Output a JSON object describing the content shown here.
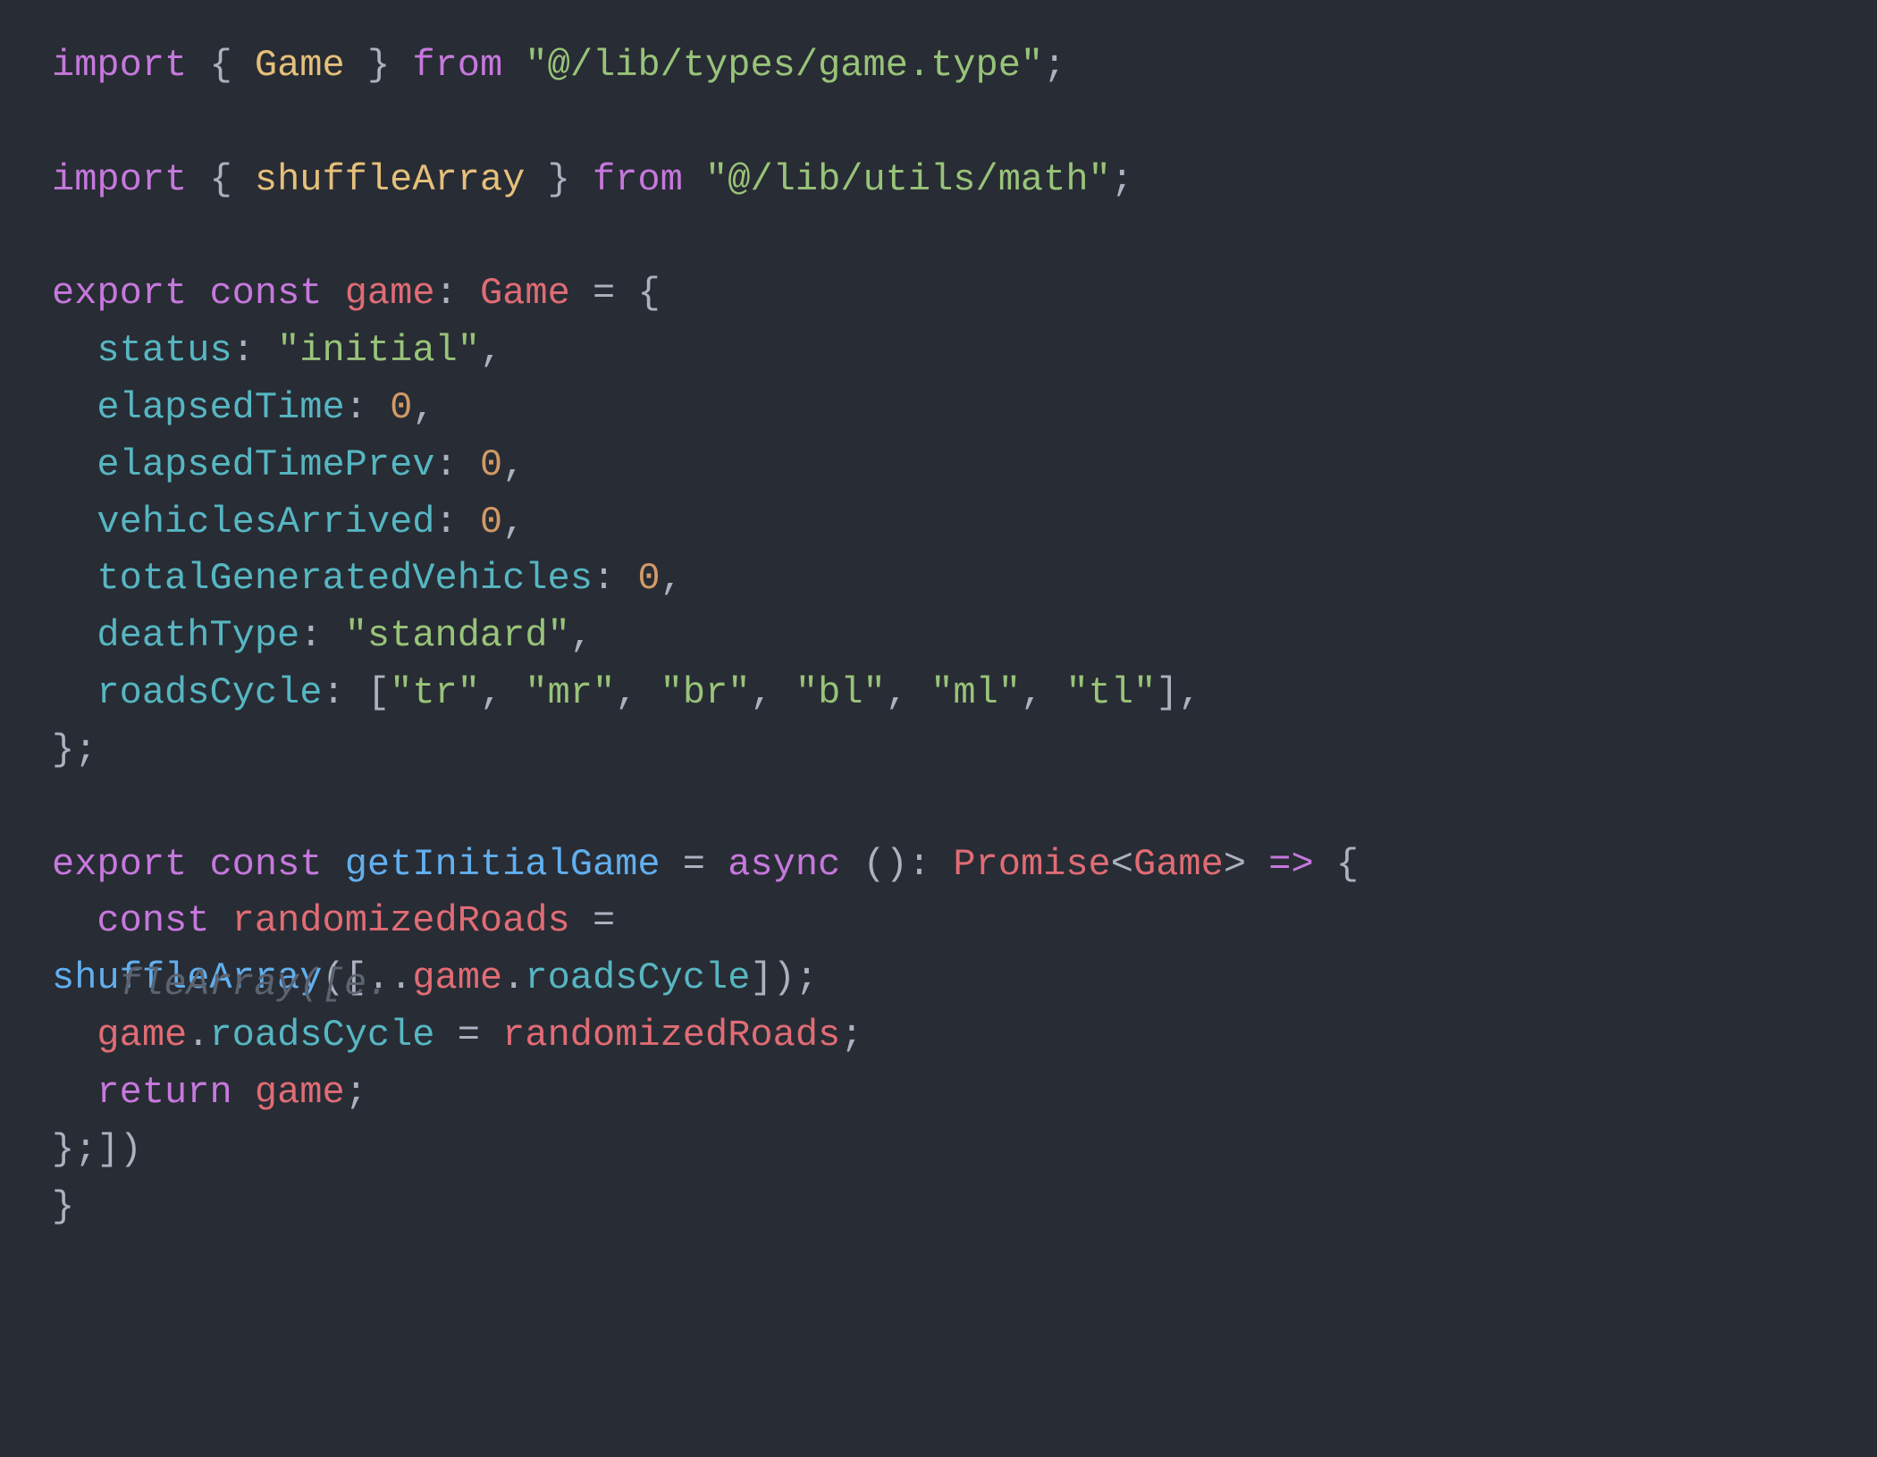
{
  "line1": {
    "kw_import": "import",
    "brace_open": "{",
    "ident_Game": "Game",
    "brace_close": "}",
    "kw_from": "from",
    "str_path": "\"@/lib/types/game.type\"",
    "semi": ";"
  },
  "line3": {
    "kw_import": "import",
    "brace_open": "{",
    "ident_shuffleArray": "shuffleArray",
    "brace_close": "}",
    "kw_from": "from",
    "str_path": "\"@/lib/utils/math\"",
    "semi": ";"
  },
  "line5": {
    "kw_export": "export",
    "kw_const": "const",
    "ident_game": "game",
    "colon": ":",
    "type_Game": "Game",
    "eq": "=",
    "brace_open": "{"
  },
  "line6": {
    "prop": "status",
    "colon": ":",
    "str": "\"initial\"",
    "comma": ","
  },
  "line7": {
    "prop": "elapsedTime",
    "colon": ":",
    "num": "0",
    "comma": ","
  },
  "line8": {
    "prop": "elapsedTimePrev",
    "colon": ":",
    "num": "0",
    "comma": ","
  },
  "line9": {
    "prop": "vehiclesArrived",
    "colon": ":",
    "num": "0",
    "comma": ","
  },
  "line10": {
    "prop": "totalGeneratedVehicles",
    "colon": ":",
    "num": "0",
    "comma": ","
  },
  "line11": {
    "prop": "deathType",
    "colon": ":",
    "str": "\"standard\"",
    "comma": ","
  },
  "line12": {
    "prop": "roadsCycle",
    "colon": ":",
    "lbrack": "[",
    "s1": "\"tr\"",
    "c1": ",",
    "s2": "\"mr\"",
    "c2": ",",
    "s3": "\"br\"",
    "c3": ",",
    "s4": "\"bl\"",
    "c4": ",",
    "s5": "\"ml\"",
    "c5": ",",
    "s6": "\"tl\"",
    "rbrack": "]",
    "comma": ","
  },
  "line13": {
    "brace_close": "}",
    "semi": ";"
  },
  "line15": {
    "kw_export": "export",
    "kw_const": "const",
    "fn": "getInitialGame",
    "eq": "=",
    "kw_async": "async",
    "parens": "()",
    "colon": ":",
    "type_Promise": "Promise",
    "lt": "<",
    "type_Game": "Game",
    "gt": ">",
    "arrow": "=>",
    "brace_open": "{"
  },
  "line16": {
    "kw_const": "const",
    "ident": "randomizedRoads",
    "eq": "="
  },
  "line17": {
    "fn": "shuffleArray",
    "lparen": "(",
    "lbrack": "[",
    "spread": "..",
    "obj": "game",
    "dot": ".",
    "prop": "roadsCycle",
    "rbrack": "]",
    "rparen": ")",
    "semi": ";"
  },
  "line17_ghost": "fleArray([e.",
  "line18": {
    "obj": "game",
    "dot": ".",
    "prop": "roadsCycle",
    "eq": "=",
    "ident": "randomizedRoads",
    "semi": ";"
  },
  "line19": {
    "kw_return": "return",
    "ident": "game",
    "semi": ";"
  },
  "line20": {
    "text": "};])"
  },
  "line21": {
    "text": "}"
  }
}
